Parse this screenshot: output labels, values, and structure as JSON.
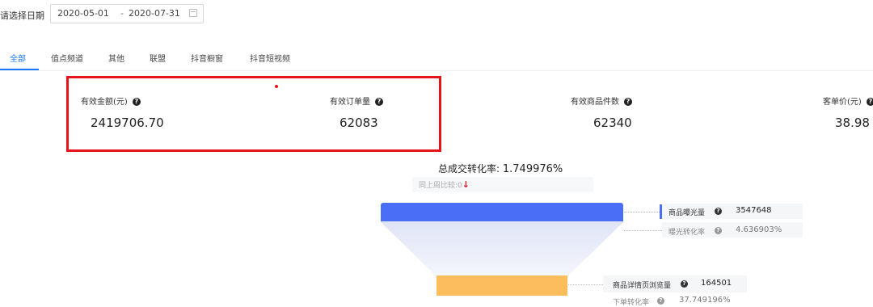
{
  "filter": {
    "label": "请选择日期",
    "start": "2020-05-01",
    "sep": "-",
    "end": "2020-07-31"
  },
  "tabs": [
    {
      "label": "全部",
      "active": true
    },
    {
      "label": "值点频道"
    },
    {
      "label": "其他"
    },
    {
      "label": "联盟"
    },
    {
      "label": "抖音橱窗"
    },
    {
      "label": "抖音短视频"
    }
  ],
  "metrics": [
    {
      "label": "有效金额(元)",
      "value": "2419706.70"
    },
    {
      "label": "有效订单量",
      "value": "62083"
    },
    {
      "label": "有效商品件数",
      "value": "62340"
    },
    {
      "label": "客单价(元)",
      "value": "38.98"
    }
  ],
  "help_glyph": "?",
  "conversion": {
    "label": "总成交转化率:",
    "value": "1.749976%",
    "compare_label": "同上周比较:",
    "compare_value": "0",
    "compare_arrow": "↓"
  },
  "funnel": {
    "stage1": {
      "label": "商品曝光量",
      "value": "3547648",
      "rate_label": "曝光转化率",
      "rate_value": "4.636903%"
    },
    "stage2": {
      "label": "商品详情页浏览量",
      "value": "164501",
      "rate_label": "下单转化率",
      "rate_value": "37.749196%"
    }
  },
  "colors": {
    "accent": "#1677ff",
    "highlight": "#e8141b",
    "funnel_blue": "#4a6ff6",
    "funnel_orange": "#fcbd5d"
  }
}
